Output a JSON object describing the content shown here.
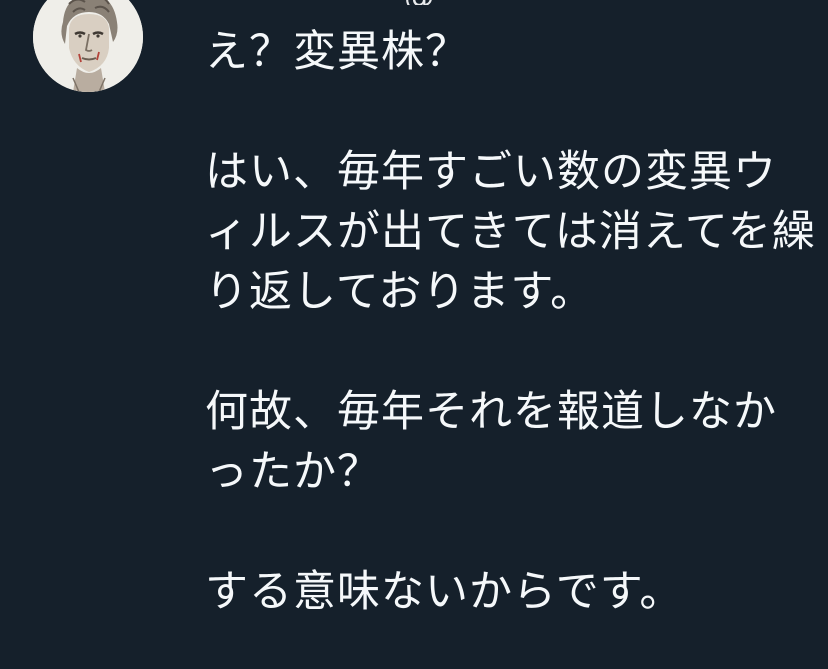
{
  "tweet": {
    "header_partial": "・・・  ・・・  @  ・・・  ・・・",
    "body": "え？変異株？\n\nはい、毎年すごい数の変異ウィルスが出てきては消えてを繰り返しております。\n\n何故、毎年それを報道しなかったか？\n\nする意味ないからです。"
  },
  "colors": {
    "background": "#15202b",
    "text": "#f5f8fa"
  },
  "icons": {
    "avatar": "statue-bust-avatar"
  }
}
